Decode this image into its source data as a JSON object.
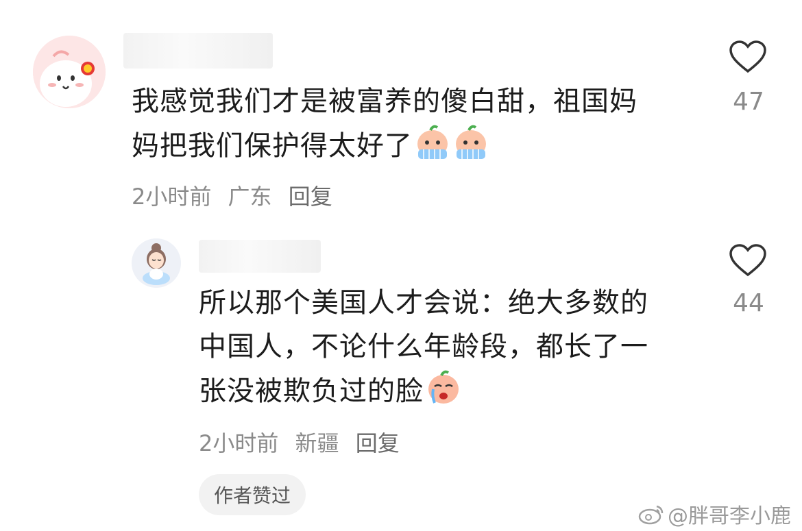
{
  "comments": [
    {
      "text_line1": "我感觉我们才是被富养的傻白甜，祖国妈",
      "text_line2": "妈把我们保护得太好了",
      "time": "2小时前",
      "location": "广东",
      "reply": "回复",
      "likes": "47",
      "emoji": [
        "crying-peach-emoji",
        "crying-peach-emoji"
      ]
    },
    {
      "text_line1": "所以那个美国人才会说：绝大多数的",
      "text_line2": "中国人，不论什么年龄段，都长了一",
      "text_line3": "张没被欺负过的脸",
      "time": "2小时前",
      "location": "新疆",
      "reply": "回复",
      "likes": "44",
      "badge": "作者赞过",
      "emoji": [
        "crying-peach-emoji"
      ]
    }
  ],
  "watermark": {
    "text": "@胖哥李小鹿"
  },
  "colors": {
    "text": "#1c1c1c",
    "meta": "#8a8a8a",
    "badge_bg": "#f2f2f2"
  }
}
